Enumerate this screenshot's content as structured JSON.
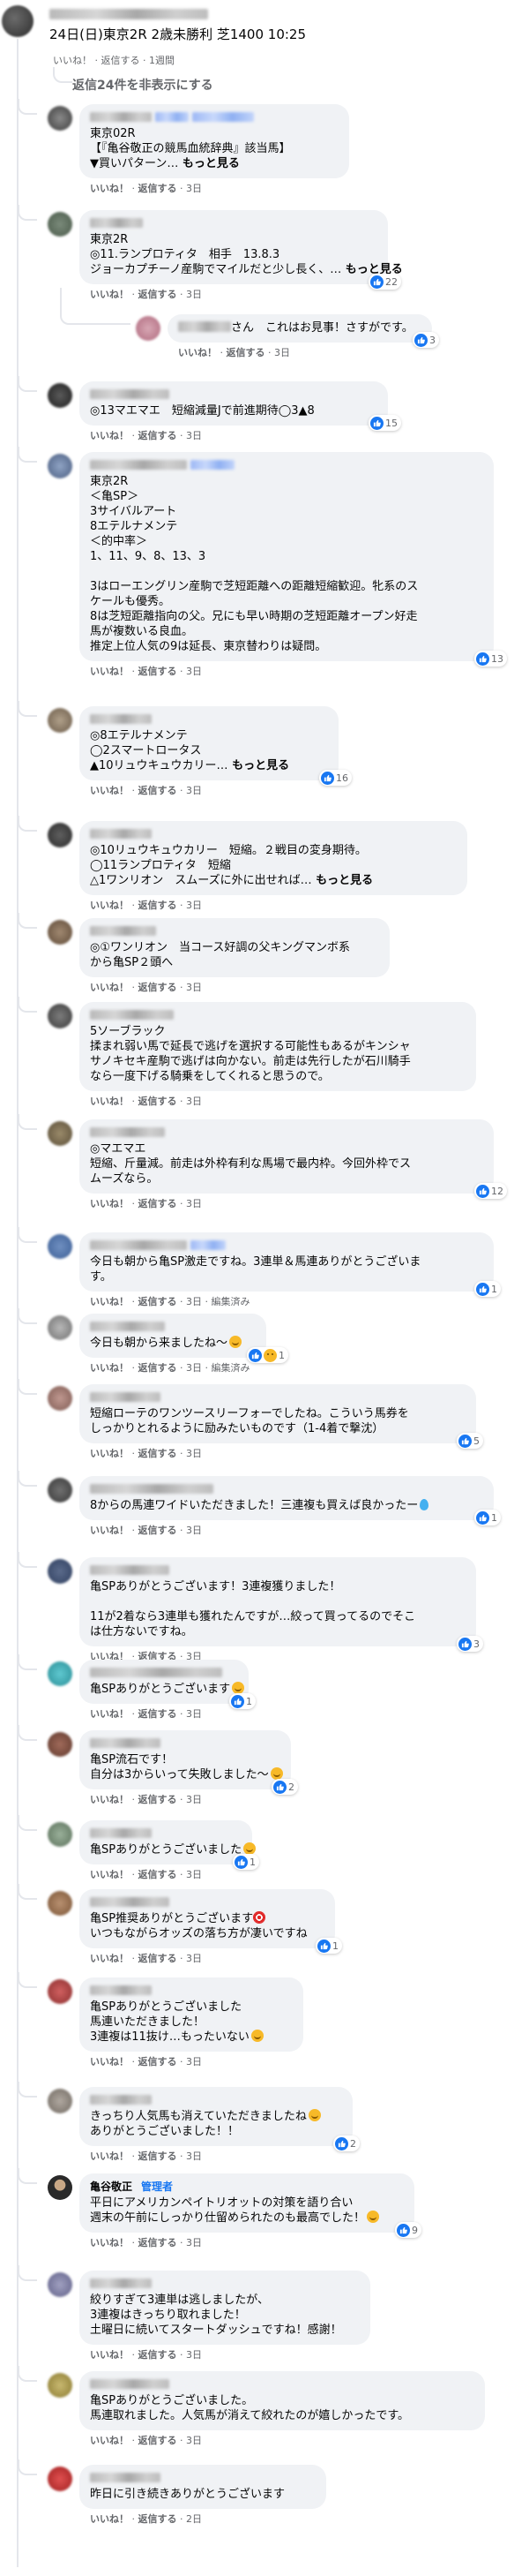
{
  "root": {
    "text": "24日(日)東京2R 2歳未勝利 芝1400 10:25",
    "actions": {
      "like": "いいね！",
      "reply": "返信する",
      "time": "1週間"
    },
    "hide_replies": "返信24件を非表示にする"
  },
  "labels": {
    "like": "いいね！",
    "reply": "返信する",
    "edited": "編集済み",
    "see_more": "もっと見る",
    "admin": "管理者"
  },
  "colors": {
    "bubble": "#f0f2f5",
    "like_blue": "#1877f2",
    "meta_gray": "#65676b",
    "line": "#e4e6eb"
  },
  "comments": [
    {
      "lines": [
        "東京02R",
        "【『亀谷敬正の競馬血統辞典』該当馬】",
        "▼買いパターン…"
      ],
      "see_more": true,
      "time": "3日",
      "reactions": null
    },
    {
      "lines": [
        "東京2R",
        "◎11.ランプロティタ　相手　13.8.3",
        "ジョーカプチーノ産駒でマイルだと少し長く、…"
      ],
      "see_more": true,
      "time": "3日",
      "reactions": "22"
    },
    {
      "lines": [
        "さん　これはお見事！さすがです。"
      ],
      "see_more": false,
      "time": "3日",
      "reactions": "3"
    },
    {
      "lines": [
        "◎13マエマエ　短縮減量Jで前進期待◯3▲8"
      ],
      "see_more": false,
      "time": "3日",
      "reactions": "15"
    },
    {
      "lines": [
        "東京2R",
        "＜亀SP＞",
        "3サイバルアート",
        "8エテルナメンテ",
        "＜的中率＞",
        "1、11、9、8、13、3",
        "",
        "3はローエングリン産駒で芝短距離への距離短縮歓迎。牝系のス",
        "ケールも優秀。",
        "8は芝短距離指向の父。兄にも早い時期の芝短距離オープン好走",
        "馬が複数いる良血。",
        "推定上位人気の9は延長、東京替わりは疑問。"
      ],
      "see_more": false,
      "time": "3日",
      "reactions": "13"
    },
    {
      "lines": [
        "◎8エテルナメンテ",
        "◯2スマートロータス",
        "▲10リュウキュウカリー…"
      ],
      "see_more": true,
      "time": "3日",
      "reactions": "16"
    },
    {
      "lines": [
        "◎10リュウキュウカリー　短縮。２戦目の変身期待。",
        "◯11ランプロティタ　短縮",
        "△1ワンリオン　スムーズに外に出せれば…"
      ],
      "see_more": true,
      "time": "3日",
      "reactions": null
    },
    {
      "lines": [
        "◎①ワンリオン　当コース好調の父キングマンボ系",
        "から亀SP２頭へ"
      ],
      "see_more": false,
      "time": "3日",
      "reactions": null
    },
    {
      "lines": [
        "5ソーブラック",
        "揉まれ弱い馬で延長で逃げを選択する可能性もあるがキンシャ",
        "サノキセキ産駒で逃げは向かない。前走は先行したが石川騎手",
        "なら一度下げる騎乗をしてくれると思うので。"
      ],
      "see_more": false,
      "time": "3日",
      "reactions": null
    },
    {
      "lines": [
        "◎マエマエ",
        "短縮、斤量減。前走は外枠有利な馬場で最内枠。今回外枠でス",
        "ムーズなら。"
      ],
      "see_more": false,
      "time": "3日",
      "reactions": "12"
    },
    {
      "lines": [
        "今日も朝から亀SP激走ですね。3連単＆馬連ありがとうございま",
        "す。"
      ],
      "see_more": false,
      "time": "3日",
      "edited": true,
      "reactions": "1"
    },
    {
      "lines": [
        "今日も朝から来ましたね〜"
      ],
      "see_more": false,
      "time": "3日",
      "edited": true,
      "reactions": "1"
    },
    {
      "lines": [
        "短縮ローテのワンツースリーフォーでしたね。こういう馬券を",
        "しっかりとれるように励みたいものです（1-4着で撃沈）"
      ],
      "see_more": false,
      "time": "3日",
      "reactions": "5"
    },
    {
      "lines": [
        "8からの馬連ワイドいただきました！三連複も買えば良かったー"
      ],
      "see_more": false,
      "time": "3日",
      "reactions": "1"
    },
    {
      "lines": [
        "亀SPありがとうございます！3連複獲りました！",
        "",
        "11が2着なら3連単も獲れたんですが…絞って買ってるのでそこ",
        "は仕方ないですね。"
      ],
      "see_more": false,
      "time": "3日",
      "reactions": "3"
    },
    {
      "lines": [
        "亀SPありがとうございます"
      ],
      "see_more": false,
      "time": "3日",
      "reactions": "1"
    },
    {
      "lines": [
        "亀SP流石です！",
        "自分は3からいって失敗しました〜"
      ],
      "see_more": false,
      "time": "3日",
      "reactions": "2"
    },
    {
      "lines": [
        "亀SPありがとうございました"
      ],
      "see_more": false,
      "time": "3日",
      "reactions": "1"
    },
    {
      "lines": [
        "亀SP推奨ありがとうございます",
        "いつもながらオッズの落ち方が凄いですね"
      ],
      "see_more": false,
      "time": "3日",
      "reactions": "1"
    },
    {
      "lines": [
        "亀SPありがとうございました",
        "馬連いただきました！",
        "3連複は11抜け…もったいない"
      ],
      "see_more": false,
      "time": "3日",
      "reactions": null
    },
    {
      "lines": [
        "きっちり人気馬も消えていただきましたね",
        "ありがとうございました！！"
      ],
      "see_more": false,
      "time": "3日",
      "reactions": "2"
    },
    {
      "name": "亀谷敬正",
      "lines": [
        "平日にアメリカンペイトリオットの対策を語り合い",
        "週末の午前にしっかり仕留められたのも最高でした！"
      ],
      "see_more": false,
      "time": "3日",
      "reactions": "9"
    },
    {
      "lines": [
        "絞りすぎて3連単は逃しましたが、",
        "3連複はきっちり取れました！",
        "土曜日に続いてスタートダッシュですね！感謝！"
      ],
      "see_more": false,
      "time": "3日",
      "reactions": null
    },
    {
      "lines": [
        "亀SPありがとうございました。",
        "馬連取れました。人気馬が消えて絞れたのが嬉しかったです。"
      ],
      "see_more": false,
      "time": "3日",
      "reactions": null
    },
    {
      "lines": [
        "昨日に引き続きありがとうございます"
      ],
      "see_more": false,
      "time": "2日",
      "reactions": null
    }
  ]
}
